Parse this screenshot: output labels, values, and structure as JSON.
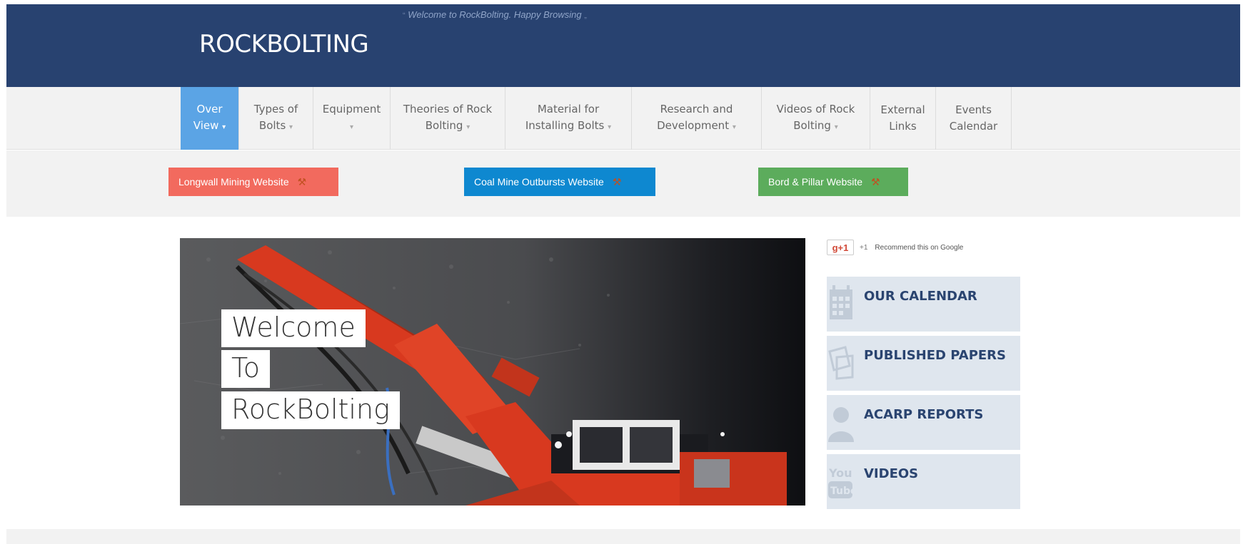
{
  "header": {
    "logo": "ROCKBOLTING",
    "tagline": "Welcome to RockBolting. Happy Browsing",
    "open_quote": "“",
    "close_quote": "„",
    "background": "#284270"
  },
  "nav": {
    "items": [
      {
        "line1": "Over",
        "line2": "View",
        "active": true
      },
      {
        "line1": "Types of",
        "line2": "Bolts"
      },
      {
        "line1": "Equipment",
        "line2": ""
      },
      {
        "line1": "Theories of Rock",
        "line2": "Bolting"
      },
      {
        "line1": "Material for",
        "line2": "Installing Bolts"
      },
      {
        "line1": "Research and",
        "line2": "Development"
      },
      {
        "line1": "Videos of Rock",
        "line2": "Bolting"
      },
      {
        "line1": "External",
        "line2": "Links"
      },
      {
        "line1": "Events",
        "line2": "Calendar"
      }
    ],
    "caret": "▾",
    "active_color": "#5ba4e5"
  },
  "site_buttons": [
    {
      "label": "Longwall Mining Website",
      "color": "#f26a5e"
    },
    {
      "label": "Coal Mine Outbursts Website",
      "color": "#0e88d0"
    },
    {
      "label": "Bord & Pillar Website",
      "color": "#5cac5c"
    }
  ],
  "hero": {
    "line1": "Welcome",
    "line2": "To",
    "line3": "RockBolting"
  },
  "gplus": {
    "button": "g+1",
    "count": "+1",
    "text": "Recommend this on Google"
  },
  "sidebar": {
    "cards": [
      {
        "label": "OUR CALENDAR",
        "icon": "calendar-icon"
      },
      {
        "label": "PUBLISHED PAPERS",
        "icon": "papers-icon"
      },
      {
        "label": "ACARP REPORTS",
        "icon": "user-icon"
      },
      {
        "label": "VIDEOS",
        "icon": "youtube-icon"
      }
    ],
    "card_color": "#dfe6ee",
    "text_color": "#2a4470"
  }
}
